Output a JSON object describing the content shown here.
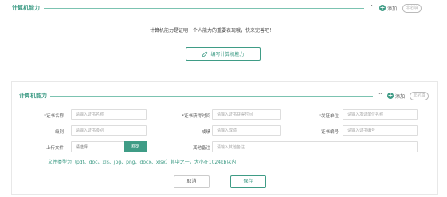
{
  "collapsed_section": {
    "title": "计算机能力",
    "add_label": "添加",
    "optional_label": "非必填",
    "intro_text": "计算机能力是证明一个人能力的重要表现哦，快来完善吧！",
    "edit_button_label": "编写计算机能力"
  },
  "form_section": {
    "title": "计算机能力",
    "add_label": "添加",
    "optional_label": "非必填",
    "fields": {
      "cert_name": {
        "label": "*证书名称",
        "placeholder": "请输入证书名称"
      },
      "obtain_time": {
        "label": "*证书获得时间",
        "placeholder": "请输入证书获得时间"
      },
      "issuer": {
        "label": "*发证单位",
        "placeholder": "请输入发证单位名称"
      },
      "level": {
        "label": "级别",
        "placeholder": "请输入证书级别"
      },
      "score": {
        "label": "成绩",
        "placeholder": "请输入成绩"
      },
      "cert_no": {
        "label": "证书编号",
        "placeholder": "请输入证书编号"
      },
      "attachment": {
        "label": "上传文件",
        "placeholder": "请选择",
        "browse_label": "浏览"
      },
      "other_notes": {
        "label": "其他备注",
        "placeholder": "请输入其他备注"
      }
    },
    "file_hint": "文件类型为（pdf、doc、xls、jpg、png、docx、xlsx）其中之一，大小在1024kb以内",
    "cancel_label": "取消",
    "save_label": "保存"
  },
  "colors": {
    "accent": "#3f9c86",
    "border": "#dddddd"
  }
}
